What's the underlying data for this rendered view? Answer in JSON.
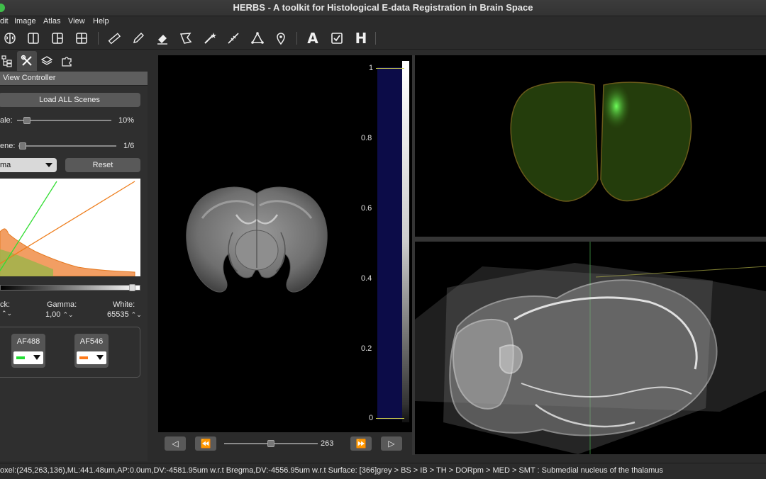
{
  "window": {
    "title": "HERBS - A toolkit for Histological E-data Registration in Brain Space"
  },
  "menu": [
    "dit",
    "Image",
    "Atlas",
    "View",
    "Help"
  ],
  "toolbar": {
    "text_tool": "A",
    "h_tool": "H",
    "icons": [
      "brain-icon",
      "layout-two-icon",
      "layout-three-icon",
      "layout-four-icon",
      "ruler-icon",
      "pencil-icon",
      "eraser-icon",
      "lasso-icon",
      "magic-wand-icon",
      "probe-icon",
      "triangle-icon",
      "location-pin-icon",
      "text-icon",
      "checkbox-icon",
      "h-icon"
    ]
  },
  "left_tabs": [
    "tree-icon",
    "tools-icon",
    "layers-icon",
    "puzzle-icon"
  ],
  "panel": {
    "title": "View Controller",
    "load_all": "Load ALL Scenes",
    "scale_label": "ale:",
    "scale_value": "10%",
    "scene_label": "ene:",
    "scene_value": "1/6",
    "combo_value": "ma",
    "reset": "Reset",
    "black_label": "ck:",
    "gamma_label": "Gamma:",
    "white_label": "White:",
    "gamma_value": "1,00",
    "white_value": "65535",
    "channels": [
      {
        "name": "AF488",
        "color": "#22dd33"
      },
      {
        "name": "AF546",
        "color": "#ff7a1a"
      }
    ]
  },
  "colorbar": {
    "ticks": [
      "1",
      "0.8",
      "0.6",
      "0.4",
      "0.2",
      "0"
    ]
  },
  "nav": {
    "slice_value": "263"
  },
  "status": "oxel:(245,263,136),ML:441.48um,AP:0.0um,DV:-4581.95um w.r.t Bregma,DV:-4556.95um w.r.t Surface: [366]grey > BS > IB > TH > DORpm > MED > SMT  :  Submedial nucleus of the thalamus"
}
